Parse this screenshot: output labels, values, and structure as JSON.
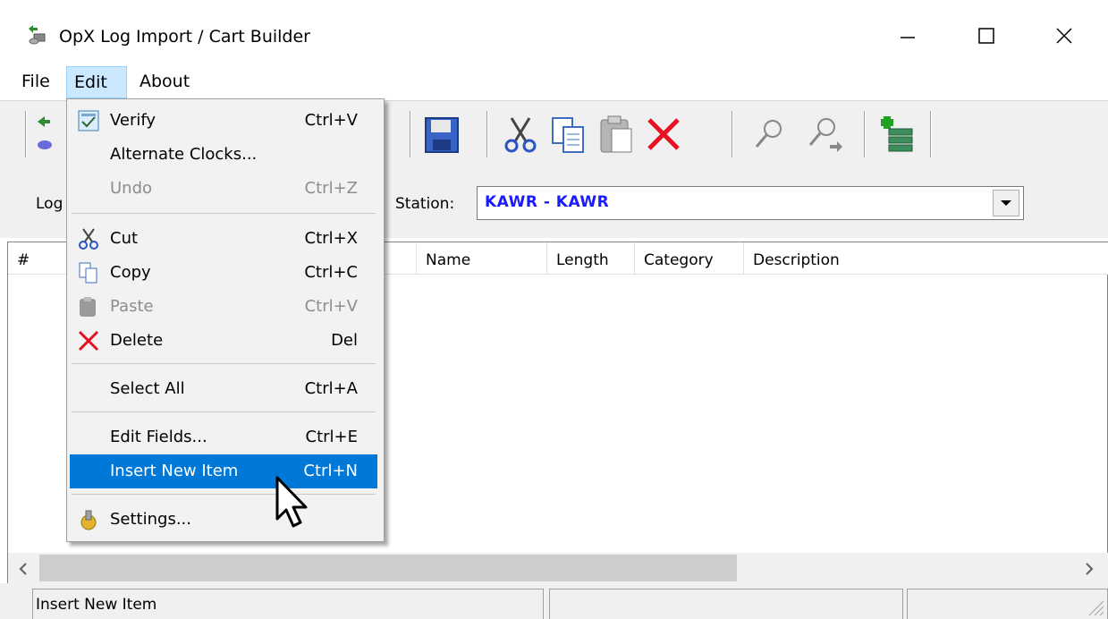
{
  "window": {
    "title": "OpX Log Import / Cart Builder",
    "minimize_glyph": "—",
    "maximize_glyph": "☐",
    "close_glyph": "✕"
  },
  "menubar": {
    "file": "File",
    "edit": "Edit",
    "about": "About"
  },
  "toolbar": {
    "icons": [
      "import-icon",
      "save-icon",
      "cut-icon",
      "copy-icon",
      "paste-icon",
      "delete-icon",
      "find-icon",
      "find-next-icon",
      "insert-list-icon"
    ]
  },
  "station": {
    "log_label": "Log",
    "label": "Station:",
    "value": "KAWR - KAWR"
  },
  "list": {
    "columns": [
      "#",
      "Name",
      "Length",
      "Category",
      "Description"
    ]
  },
  "edit_menu": {
    "items": [
      {
        "label": "Verify",
        "shortcut": "Ctrl+V",
        "enabled": true,
        "icon": "checkbox-icon"
      },
      {
        "label": "Alternate Clocks...",
        "shortcut": "",
        "enabled": true,
        "icon": ""
      },
      {
        "label": "Undo",
        "shortcut": "Ctrl+Z",
        "enabled": false,
        "icon": ""
      },
      {
        "label": "Cut",
        "shortcut": "Ctrl+X",
        "enabled": true,
        "icon": "scissors-icon"
      },
      {
        "label": "Copy",
        "shortcut": "Ctrl+C",
        "enabled": true,
        "icon": "copy-icon"
      },
      {
        "label": "Paste",
        "shortcut": "Ctrl+V",
        "enabled": false,
        "icon": "paste-icon"
      },
      {
        "label": "Delete",
        "shortcut": "Del",
        "enabled": true,
        "icon": "delete-icon"
      },
      {
        "label": "Select All",
        "shortcut": "Ctrl+A",
        "enabled": true,
        "icon": ""
      },
      {
        "label": "Edit Fields...",
        "shortcut": "Ctrl+E",
        "enabled": true,
        "icon": ""
      },
      {
        "label": "Insert New Item",
        "shortcut": "Ctrl+N",
        "enabled": true,
        "icon": "",
        "highlighted": true
      },
      {
        "label": "Settings...",
        "shortcut": "",
        "enabled": true,
        "icon": "settings-icon"
      }
    ]
  },
  "statusbar": {
    "text": "Insert New Item"
  },
  "colors": {
    "highlight": "#0078d7",
    "station_text": "#1a1aff",
    "delete_red": "#e81123"
  }
}
